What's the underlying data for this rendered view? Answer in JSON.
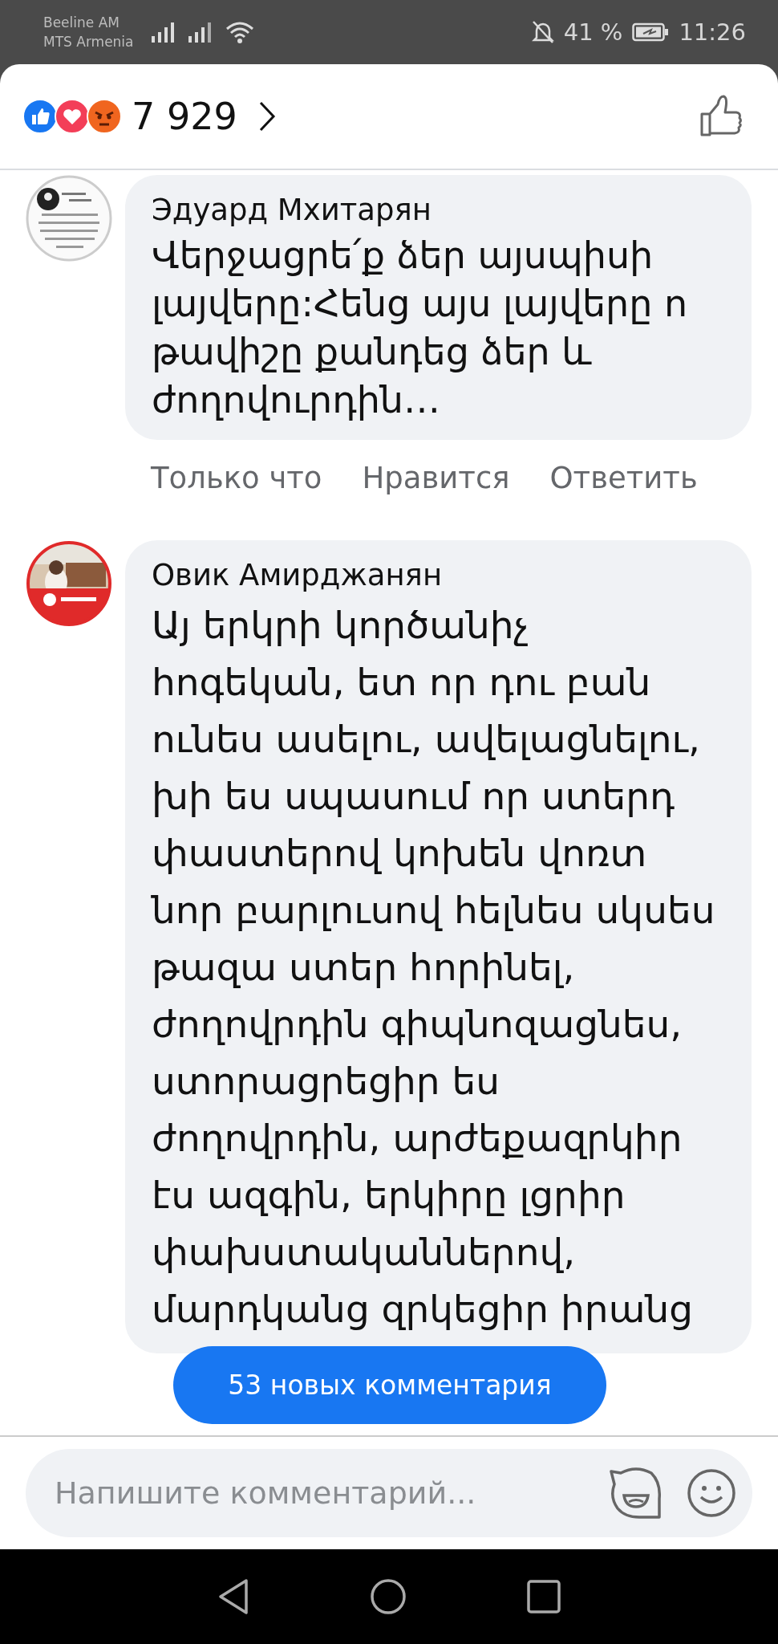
{
  "status_bar": {
    "carriers": [
      "Beeline AM",
      "MTS Armenia"
    ],
    "battery": "41 %",
    "time": "11:26"
  },
  "reactions": {
    "count": "7 929"
  },
  "comments": [
    {
      "author": "Эдуард Мхитарян",
      "lines": [
        "Վերջացրե՛ք ձեր այսպիսի",
        "լայվերը:Հենց այս լայվերը ո",
        "թավիշը քանդեց ձեր և",
        "ժողովուրդին…"
      ],
      "actions": [
        "Только что",
        "Нравится",
        "Ответить"
      ]
    },
    {
      "author": "Овик Амирджанян",
      "lines": [
        "Այ երկրի կործանիչ",
        "հոգեկան, ետ որ դու բան",
        "ունես ասելու, ավելացնելու,",
        "խի ես սպասում որ ստերդ",
        "փաստերով կոխեն վոռտ",
        "նոր բարլուսով հելնես սկսես",
        "թազա ստեր հորինել,",
        "ժողովրդին գիպնոզացնես,",
        "ստորացրեցիր ես",
        "ժողովրդին, արժեքազրկիր",
        "էս ազգին, երկիրը լցրիր",
        "փախստականներով,",
        "մարդկանց զրկեցիր իրանց"
      ]
    }
  ],
  "new_comments_button": "53 новых комментария",
  "composer": {
    "placeholder": "Напишите комментарий..."
  }
}
